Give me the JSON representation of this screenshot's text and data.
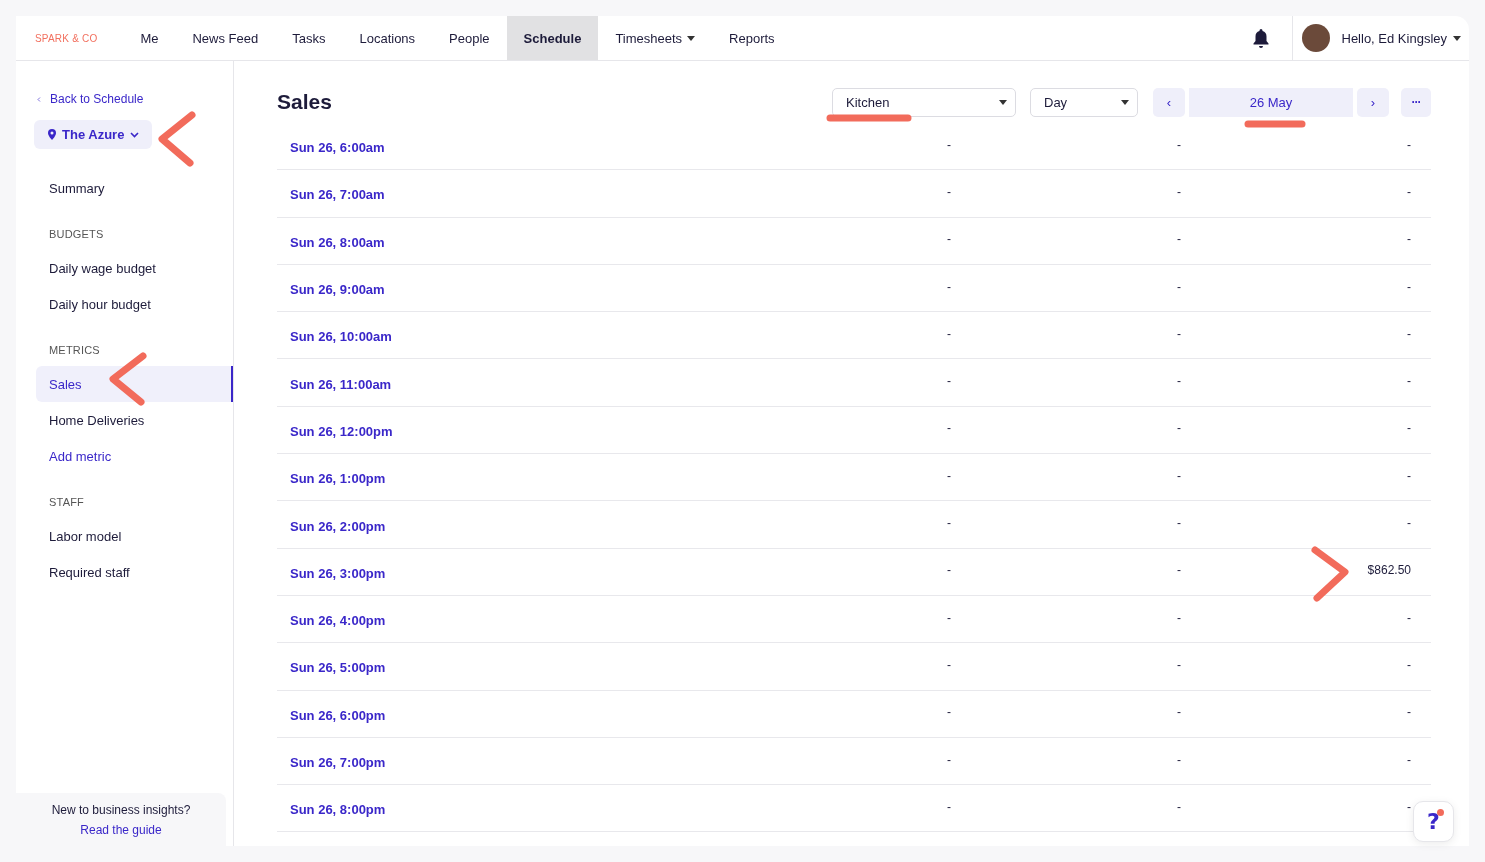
{
  "logo": "SPARK & CO",
  "nav": [
    {
      "label": "Me",
      "selected": false,
      "dropdown": false
    },
    {
      "label": "News Feed",
      "selected": false,
      "dropdown": false
    },
    {
      "label": "Tasks",
      "selected": false,
      "dropdown": false
    },
    {
      "label": "Locations",
      "selected": false,
      "dropdown": false
    },
    {
      "label": "People",
      "selected": false,
      "dropdown": false
    },
    {
      "label": "Schedule",
      "selected": true,
      "dropdown": false
    },
    {
      "label": "Timesheets",
      "selected": false,
      "dropdown": true
    },
    {
      "label": "Reports",
      "selected": false,
      "dropdown": false
    }
  ],
  "user": {
    "greeting": "Hello, Ed Kingsley"
  },
  "sidebar": {
    "back": "Back to Schedule",
    "location": "The Azure",
    "sections": [
      {
        "items": [
          {
            "label": "Summary",
            "kind": "item",
            "selected": false
          }
        ]
      },
      {
        "heading": "BUDGETS",
        "items": [
          {
            "label": "Daily wage budget",
            "kind": "item",
            "selected": false
          },
          {
            "label": "Daily hour budget",
            "kind": "item",
            "selected": false
          }
        ]
      },
      {
        "heading": "METRICS",
        "items": [
          {
            "label": "Sales",
            "kind": "item",
            "selected": true
          },
          {
            "label": "Home Deliveries",
            "kind": "item",
            "selected": false
          },
          {
            "label": "Add metric",
            "kind": "link",
            "selected": false
          }
        ]
      },
      {
        "heading": "STAFF",
        "items": [
          {
            "label": "Labor model",
            "kind": "item",
            "selected": false
          },
          {
            "label": "Required staff",
            "kind": "item",
            "selected": false
          }
        ]
      }
    ],
    "guide": {
      "text": "New to business insights?",
      "link": "Read the guide"
    }
  },
  "main": {
    "title": "Sales",
    "department": "Kitchen",
    "period": "Day",
    "date": "26 May",
    "prev": "‹",
    "next": "›",
    "more": "···",
    "table": {
      "rows": [
        {
          "time": "Sun 26, 6:00am",
          "column_2": "-",
          "column_3": "-",
          "column_4": "-"
        },
        {
          "time": "Sun 26, 7:00am",
          "column_2": "-",
          "column_3": "-",
          "column_4": "-"
        },
        {
          "time": "Sun 26, 8:00am",
          "column_2": "-",
          "column_3": "-",
          "column_4": "-"
        },
        {
          "time": "Sun 26, 9:00am",
          "column_2": "-",
          "column_3": "-",
          "column_4": "-"
        },
        {
          "time": "Sun 26, 10:00am",
          "column_2": "-",
          "column_3": "-",
          "column_4": "-"
        },
        {
          "time": "Sun 26, 11:00am",
          "column_2": "-",
          "column_3": "-",
          "column_4": "-"
        },
        {
          "time": "Sun 26, 12:00pm",
          "column_2": "-",
          "column_3": "-",
          "column_4": "-"
        },
        {
          "time": "Sun 26, 1:00pm",
          "column_2": "-",
          "column_3": "-",
          "column_4": "-"
        },
        {
          "time": "Sun 26, 2:00pm",
          "column_2": "-",
          "column_3": "-",
          "column_4": "-"
        },
        {
          "time": "Sun 26, 3:00pm",
          "column_2": "-",
          "column_3": "-",
          "column_4": "$862.50"
        },
        {
          "time": "Sun 26, 4:00pm",
          "column_2": "-",
          "column_3": "-",
          "column_4": "-"
        },
        {
          "time": "Sun 26, 5:00pm",
          "column_2": "-",
          "column_3": "-",
          "column_4": "-"
        },
        {
          "time": "Sun 26, 6:00pm",
          "column_2": "-",
          "column_3": "-",
          "column_4": "-"
        },
        {
          "time": "Sun 26, 7:00pm",
          "column_2": "-",
          "column_3": "-",
          "column_4": "-"
        },
        {
          "time": "Sun 26, 8:00pm",
          "column_2": "-",
          "column_3": "-",
          "column_4": "-"
        }
      ]
    }
  },
  "help": {
    "label": "?"
  }
}
